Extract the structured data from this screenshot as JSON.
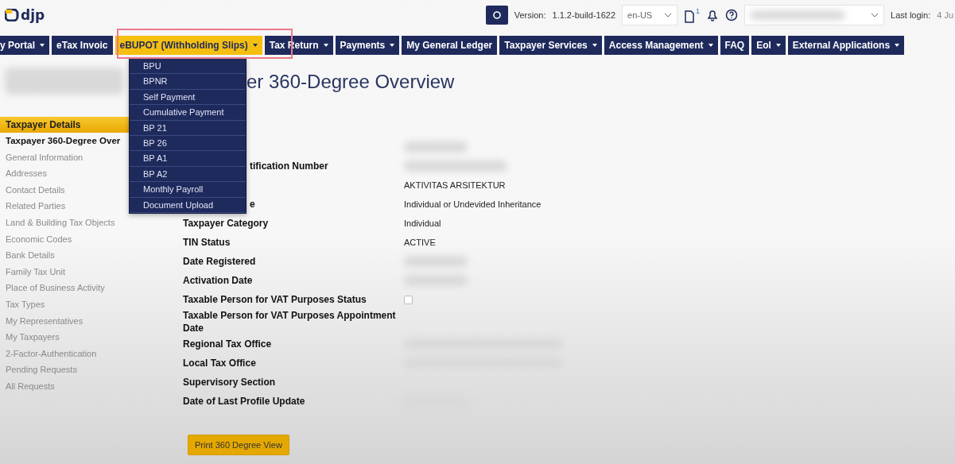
{
  "header": {
    "logo": "djp",
    "version_label": "Version:",
    "version": "1.1.2-build-1622",
    "language": "en-US",
    "document_badge": "1",
    "last_login_label": "Last login:",
    "last_login": "4 Ju"
  },
  "nav": [
    {
      "label": "y Portal",
      "caret": true,
      "selected": false
    },
    {
      "label": "eTax Invoic",
      "caret": false,
      "selected": false
    },
    {
      "label": "eBUPOT (Withholding Slips)",
      "caret": true,
      "selected": true
    },
    {
      "label": "Tax Return",
      "caret": true,
      "selected": false
    },
    {
      "label": "Payments",
      "caret": true,
      "selected": false
    },
    {
      "label": "My General Ledger",
      "caret": false,
      "selected": false
    },
    {
      "label": "Taxpayer Services",
      "caret": true,
      "selected": false
    },
    {
      "label": "Access Management",
      "caret": true,
      "selected": false
    },
    {
      "label": "FAQ",
      "caret": false,
      "selected": false
    },
    {
      "label": "EoI",
      "caret": true,
      "selected": false
    },
    {
      "label": "External Applications",
      "caret": true,
      "selected": false
    }
  ],
  "dropdown": [
    "BPU",
    "BPNR",
    "Self Payment",
    "Cumulative Payment",
    "BP 21",
    "BP 26",
    "BP A1",
    "BP A2",
    "Monthly Payroll",
    "Document Upload"
  ],
  "sidebar": {
    "header": "Taxpayer Details",
    "items": [
      {
        "label": "Taxpayer 360-Degree Over",
        "selected": true
      },
      {
        "label": "General Information",
        "selected": false
      },
      {
        "label": "Addresses",
        "selected": false
      },
      {
        "label": "Contact Details",
        "selected": false
      },
      {
        "label": "Related Parties",
        "selected": false
      },
      {
        "label": "Land & Building Tax Objects",
        "selected": false
      },
      {
        "label": "Economic Codes",
        "selected": false
      },
      {
        "label": "Bank Details",
        "selected": false
      },
      {
        "label": "Family Tax Unit",
        "selected": false
      },
      {
        "label": "Place of Business Activity",
        "selected": false
      },
      {
        "label": "Tax Types",
        "selected": false
      },
      {
        "label": "My Representatives",
        "selected": false
      },
      {
        "label": "My Taxpayers",
        "selected": false
      },
      {
        "label": "2-Factor-Authentication",
        "selected": false
      },
      {
        "label": "Pending Requests",
        "selected": false
      },
      {
        "label": "All Requests",
        "selected": false
      }
    ]
  },
  "page_title": "er 360-Degree Overview",
  "details": [
    {
      "kind": "redacted"
    },
    {
      "label": "tification Number",
      "covered": true,
      "kind": "redacted"
    },
    {
      "kind": "text",
      "value": "AKTIVITAS ARSITEKTUR"
    },
    {
      "label": "e",
      "covered": true,
      "kind": "text",
      "value": "Individual or Undevided Inheritance"
    },
    {
      "label": "Taxpayer Category",
      "covered": false,
      "kind": "text",
      "value": "Individual"
    },
    {
      "label": "TIN Status",
      "covered": false,
      "kind": "text",
      "value": "ACTIVE"
    },
    {
      "label": "Date Registered",
      "covered": false,
      "kind": "redacted"
    },
    {
      "label": "Activation Date",
      "covered": false,
      "kind": "redacted"
    },
    {
      "label": "Taxable Person for VAT Purposes Status",
      "covered": false,
      "kind": "checkbox",
      "checked": false
    },
    {
      "label": "Taxable Person for VAT Purposes Appointment Date",
      "covered": false,
      "kind": "empty"
    },
    {
      "label": "Regional Tax Office",
      "covered": false,
      "kind": "redacted"
    },
    {
      "label": "Local Tax Office",
      "covered": false,
      "kind": "redacted"
    },
    {
      "label": "Supervisory Section",
      "covered": false,
      "kind": "empty"
    },
    {
      "label": "Date of Last Profile Update",
      "covered": false,
      "kind": "redacted"
    }
  ],
  "print_button": "Print 360 Degree View"
}
